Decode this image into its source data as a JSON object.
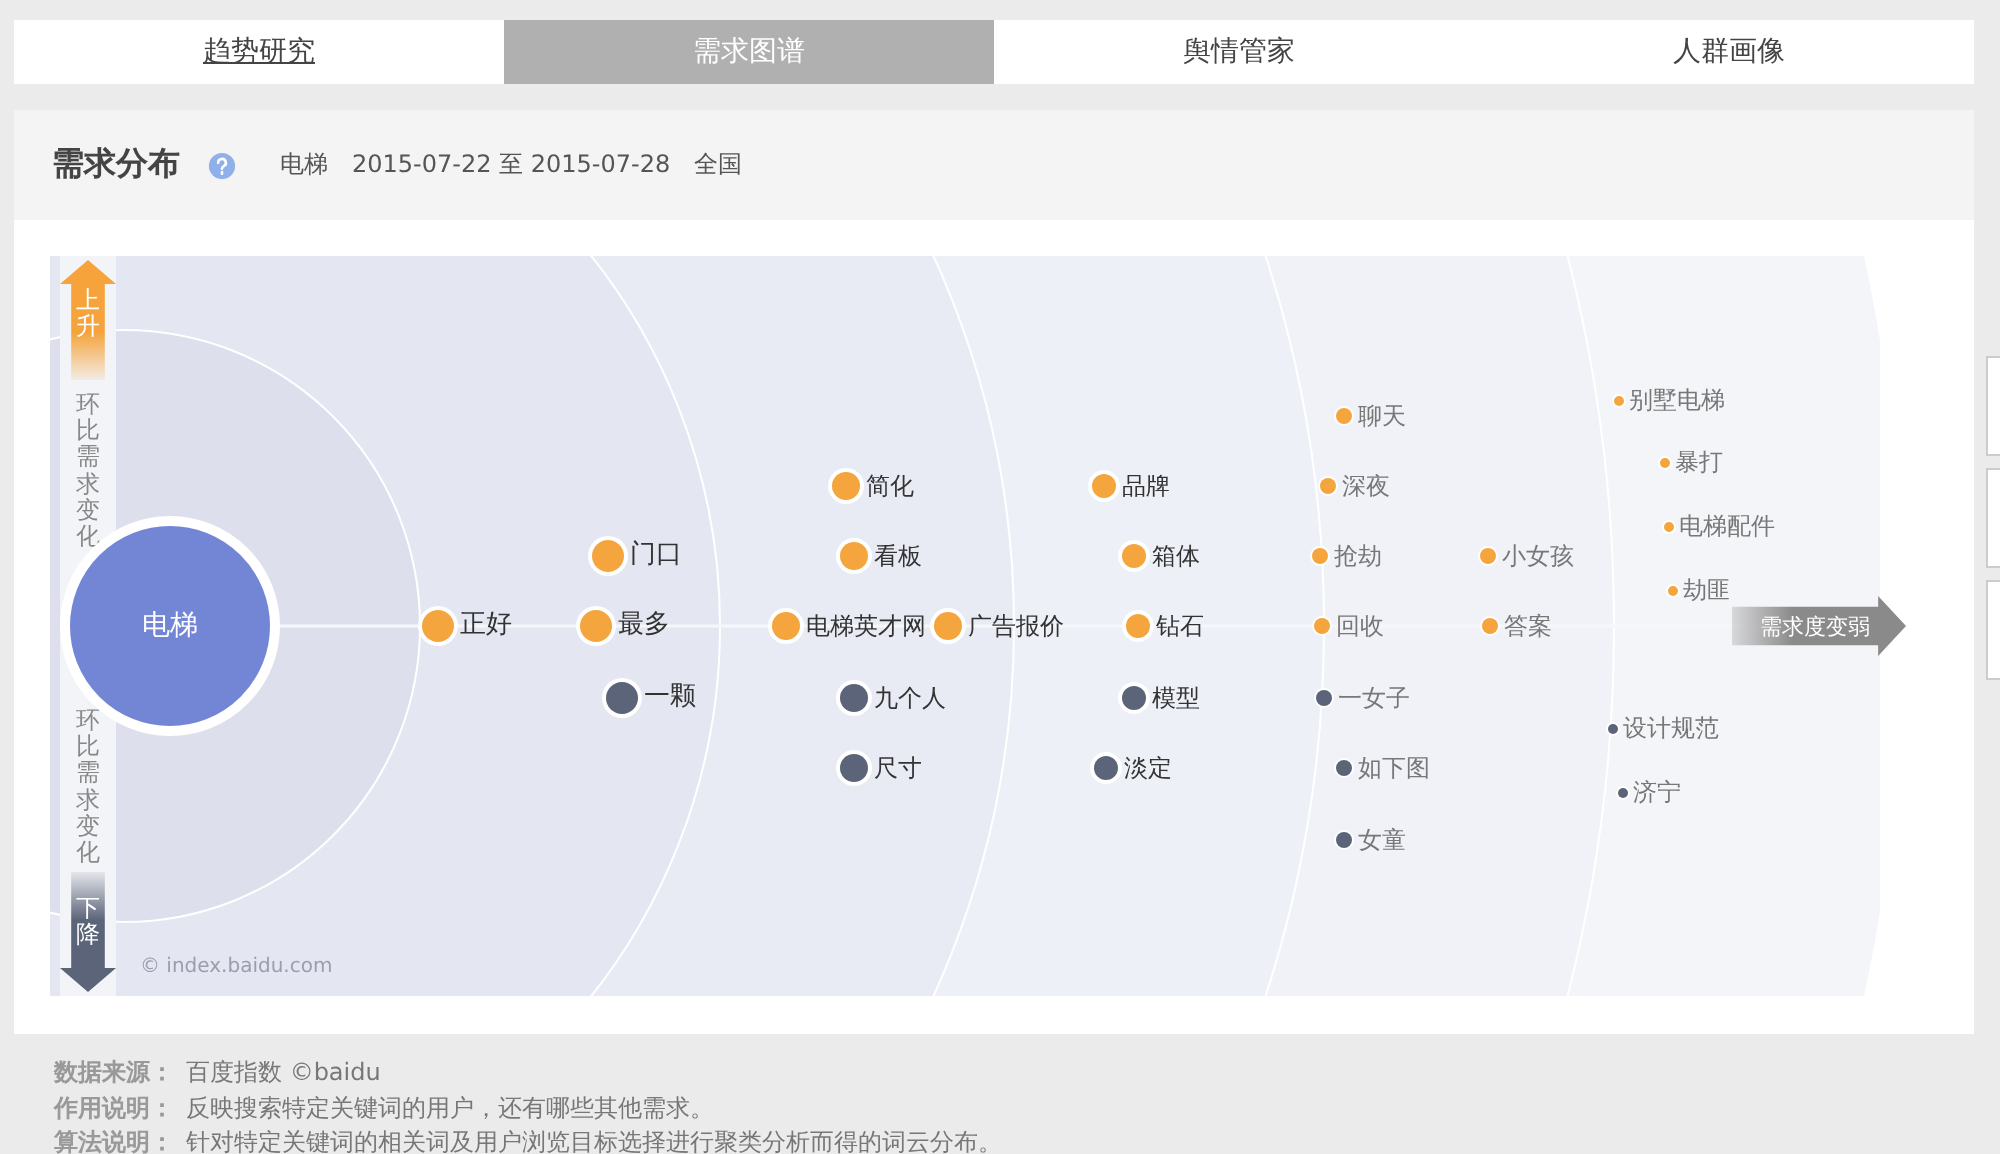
{
  "tabs": [
    {
      "label": "趋势研究",
      "selected": false,
      "underlined": true
    },
    {
      "label": "需求图谱",
      "selected": true,
      "underlined": false
    },
    {
      "label": "舆情管家",
      "selected": false,
      "underlined": false
    },
    {
      "label": "人群画像",
      "selected": false,
      "underlined": false
    }
  ],
  "header": {
    "title": "需求分布",
    "meta": [
      "电梯",
      "2015-07-22 至 2015-07-28",
      "全国"
    ]
  },
  "chart": {
    "center": "电梯",
    "up_label": "上升",
    "up_caption": "环比需求变化",
    "down_caption": "环比需求变化",
    "down_label": "下降",
    "direction_label": "需求度变弱",
    "credit": "© index.baidu.com",
    "rings": [
      {
        "words": [
          {
            "text": "正好",
            "rising": true
          }
        ]
      },
      {
        "words": [
          {
            "text": "门口",
            "rising": true
          },
          {
            "text": "最多",
            "rising": true
          },
          {
            "text": "一颗",
            "rising": false
          }
        ]
      },
      {
        "words": [
          {
            "text": "简化",
            "rising": true
          },
          {
            "text": "看板",
            "rising": true
          },
          {
            "text": "电梯英才网",
            "rising": true
          },
          {
            "text": "广告报价",
            "rising": true
          },
          {
            "text": "九个人",
            "rising": false
          },
          {
            "text": "尺寸",
            "rising": false
          }
        ]
      },
      {
        "words": [
          {
            "text": "品牌",
            "rising": true
          },
          {
            "text": "箱体",
            "rising": true
          },
          {
            "text": "钻石",
            "rising": true
          },
          {
            "text": "模型",
            "rising": false
          },
          {
            "text": "淡定",
            "rising": false
          }
        ]
      },
      {
        "words": [
          {
            "text": "聊天",
            "rising": true
          },
          {
            "text": "深夜",
            "rising": true
          },
          {
            "text": "抢劫",
            "rising": true
          },
          {
            "text": "小女孩",
            "rising": true
          },
          {
            "text": "回收",
            "rising": true
          },
          {
            "text": "答案",
            "rising": true
          },
          {
            "text": "一女子",
            "rising": false
          },
          {
            "text": "如下图",
            "rising": false
          },
          {
            "text": "女童",
            "rising": false
          }
        ]
      },
      {
        "words": [
          {
            "text": "别墅电梯",
            "rising": true
          },
          {
            "text": "暴打",
            "rising": true
          },
          {
            "text": "电梯配件",
            "rising": true
          },
          {
            "text": "劫匪",
            "rising": true
          },
          {
            "text": "设计规范",
            "rising": false
          },
          {
            "text": "济宁",
            "rising": false
          }
        ]
      }
    ]
  },
  "footer": [
    {
      "label": "数据来源：",
      "text": "百度指数 ©baidu"
    },
    {
      "label": "作用说明：",
      "text": "反映搜索特定关键词的用户，还有哪些其他需求。"
    },
    {
      "label": "算法说明：",
      "text": "针对特定关键词的相关词及用户浏览目标选择进行聚类分析而得的词云分布。"
    }
  ]
}
